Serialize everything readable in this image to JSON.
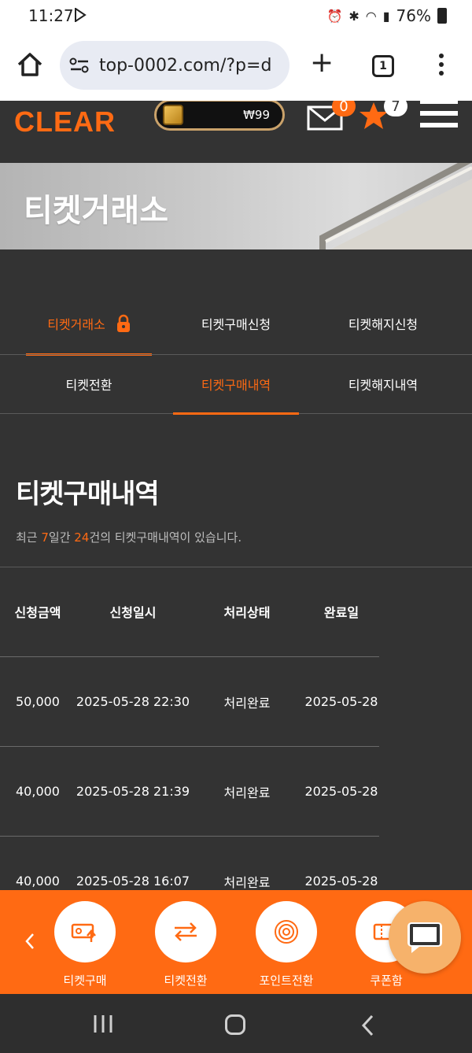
{
  "status_bar": {
    "time": "11:27",
    "battery": "76%"
  },
  "browser": {
    "url": "top-0002.com/?p=d",
    "tab_count": "1"
  },
  "header": {
    "logo": "CLEAR",
    "wallet_amount": "₩99",
    "mail_badge": "0",
    "star_badge": "7"
  },
  "banner": {
    "title": "티켓거래소"
  },
  "tabs": {
    "row1": [
      "티켓거래소",
      "티켓구매신청",
      "티켓해지신청"
    ],
    "row2": [
      "티켓전환",
      "티켓구매내역",
      "티켓해지내역"
    ],
    "active_row1": 0,
    "active_row2": 1
  },
  "history": {
    "title": "티켓구매내역",
    "desc_prefix": "최근 ",
    "desc_days": "7",
    "desc_mid": "일간 ",
    "desc_count": "24",
    "desc_suffix": "건의 티켓구매내역이 있습니다.",
    "columns": [
      "신청금액",
      "신청일시",
      "처리상태",
      "완료일"
    ],
    "rows": [
      [
        "50,000",
        "2025-05-28 22:30",
        "처리완료",
        "2025-05-28"
      ],
      [
        "40,000",
        "2025-05-28 21:39",
        "처리완료",
        "2025-05-28"
      ],
      [
        "40,000",
        "2025-05-28 16:07",
        "처리완료",
        "2025-05-28"
      ]
    ]
  },
  "quick_menu": {
    "items": [
      "티켓구매",
      "티켓전환",
      "포인트전환",
      "쿠폰함"
    ]
  },
  "colors": {
    "accent": "#ff6a13",
    "background": "#333333"
  }
}
